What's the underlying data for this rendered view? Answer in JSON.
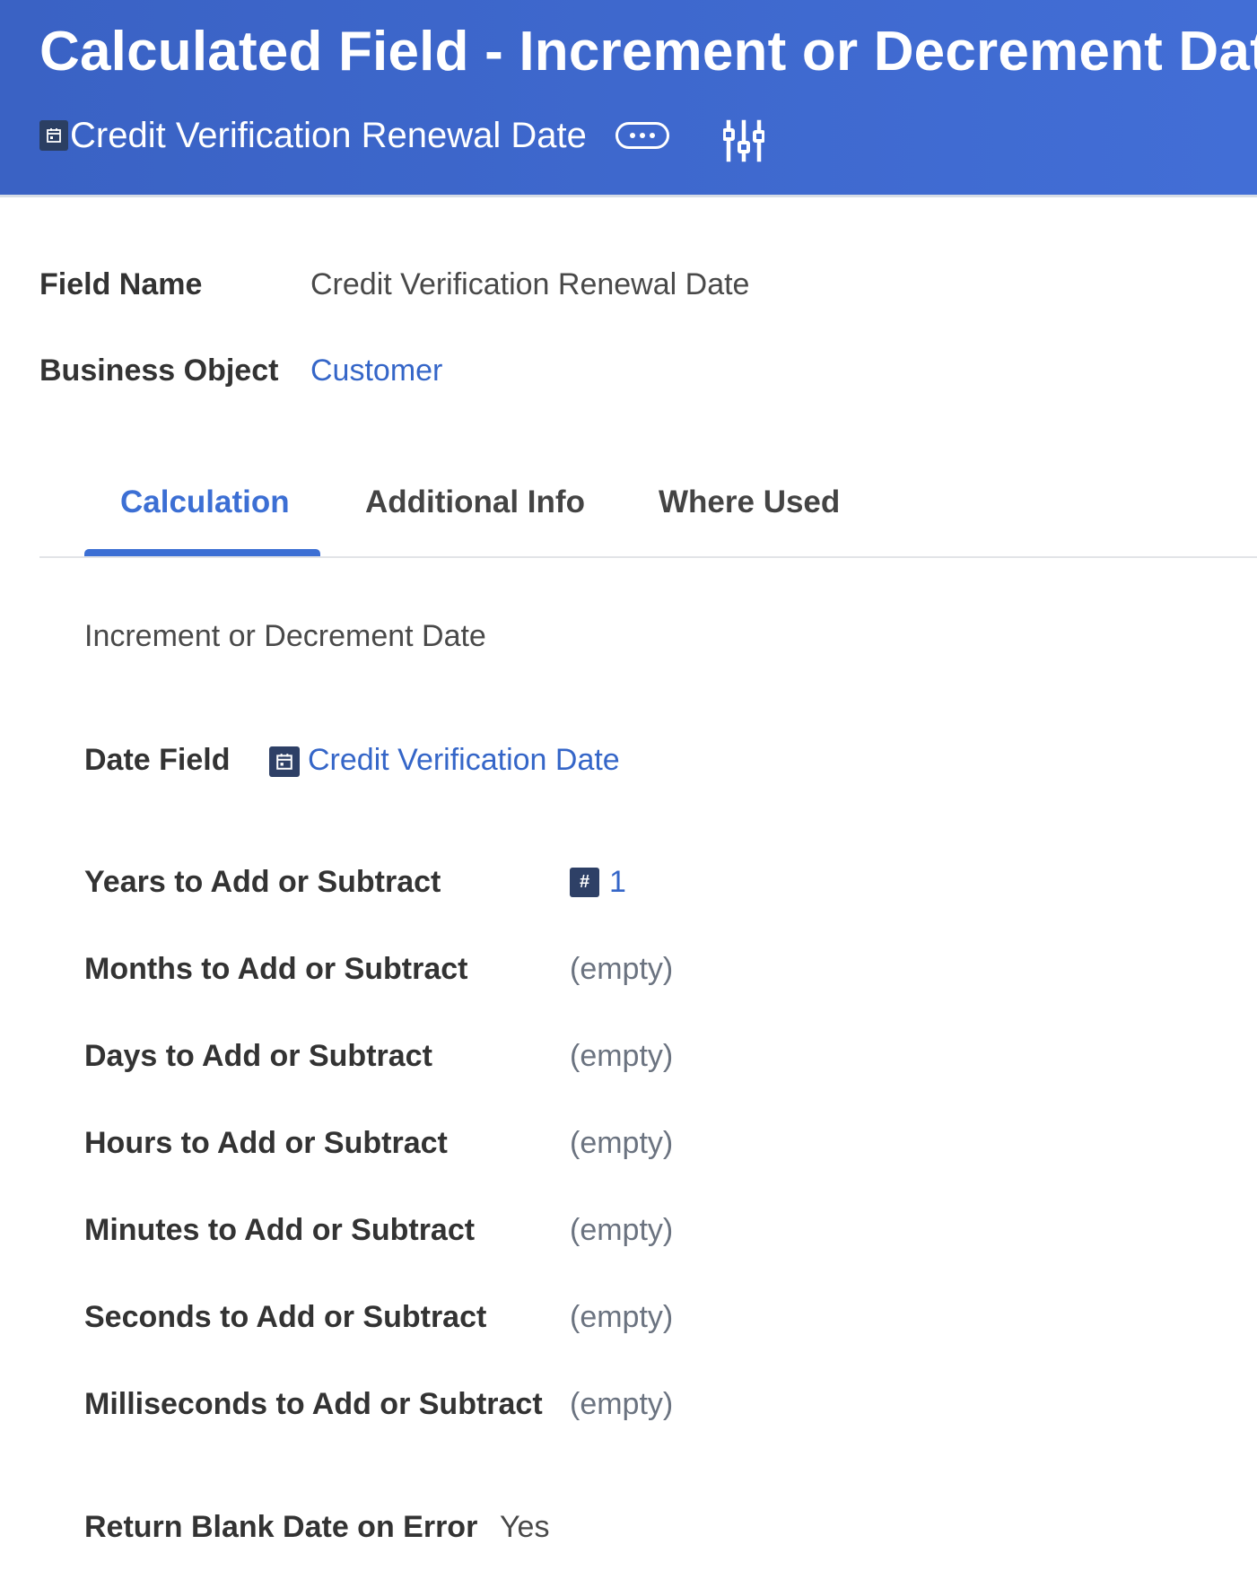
{
  "header": {
    "title": "Calculated Field - Increment or Decrement Date",
    "subtitle": "Credit Verification Renewal Date",
    "subtitle_icon": "calendar-icon",
    "more_icon": "more-horizontal-icon",
    "related_actions_icon": "related-actions-icon"
  },
  "summary": {
    "field_name_label": "Field Name",
    "field_name_value": "Credit Verification Renewal Date",
    "business_object_label": "Business Object",
    "business_object_value": "Customer"
  },
  "tabs": [
    {
      "label": "Calculation",
      "active": true
    },
    {
      "label": "Additional Info",
      "active": false
    },
    {
      "label": "Where Used",
      "active": false
    }
  ],
  "calculation": {
    "heading": "Increment or Decrement Date",
    "date_field_label": "Date Field",
    "date_field_value": "Credit Verification Date",
    "date_field_icon": "calendar-icon",
    "number_icon_glyph": "#",
    "rows": [
      {
        "label": "Years to Add or Subtract",
        "value": "1"
      },
      {
        "label": "Months to Add or Subtract",
        "value": "(empty)"
      },
      {
        "label": "Days to Add or Subtract",
        "value": "(empty)"
      },
      {
        "label": "Hours to Add or Subtract",
        "value": "(empty)"
      },
      {
        "label": "Minutes to Add or Subtract",
        "value": "(empty)"
      },
      {
        "label": "Seconds to Add or Subtract",
        "value": "(empty)"
      },
      {
        "label": "Milliseconds to Add or Subtract",
        "value": "(empty)"
      }
    ],
    "return_blank_label": "Return Blank Date on Error",
    "return_blank_value": "Yes"
  },
  "colors": {
    "header_bg": "#3f6ad0",
    "link": "#3566c8",
    "tab_active": "#3c6fd4"
  }
}
